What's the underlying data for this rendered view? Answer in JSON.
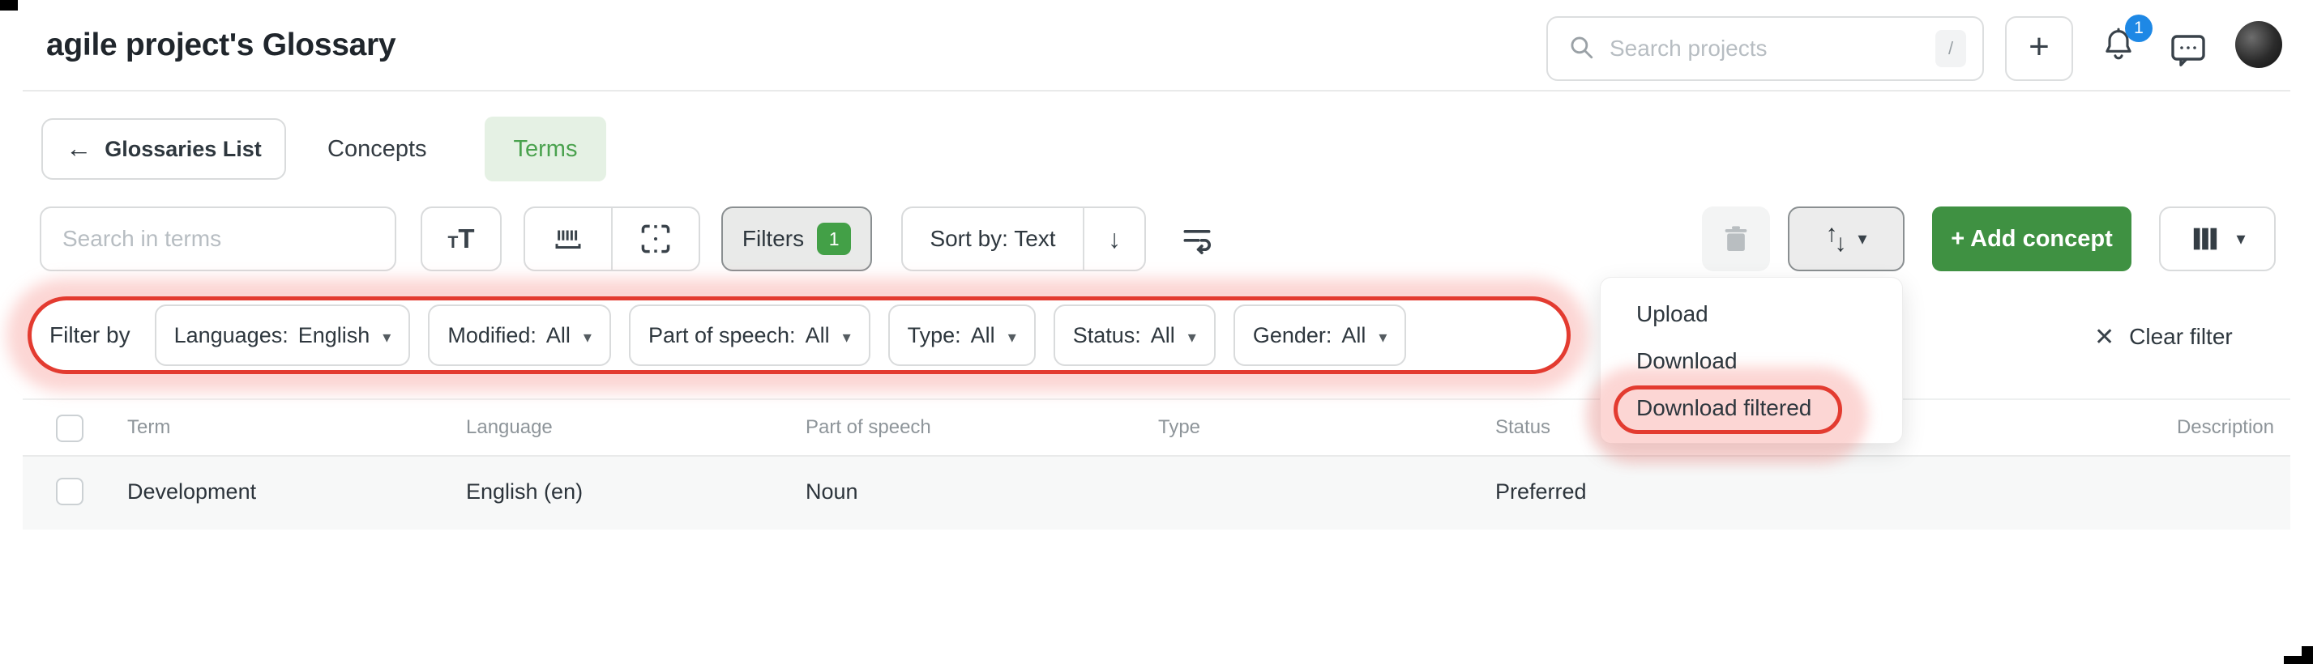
{
  "header": {
    "title": "agile project's Glossary",
    "search": {
      "placeholder": "Search projects",
      "shortcut": "/"
    },
    "notification_count": "1"
  },
  "nav": {
    "back_button": "Glossaries List",
    "tabs": [
      {
        "label": "Concepts",
        "active": false
      },
      {
        "label": "Terms",
        "active": true
      }
    ]
  },
  "toolbar": {
    "search_placeholder": "Search in terms",
    "filters_label": "Filters",
    "filters_count": "1",
    "sort_label": "Sort by: Text",
    "add_concept_label": "+ Add concept"
  },
  "filter_bar": {
    "label": "Filter by",
    "filters": [
      {
        "label": "Languages:",
        "value": "English"
      },
      {
        "label": "Modified:",
        "value": "All"
      },
      {
        "label": "Part of speech:",
        "value": "All"
      },
      {
        "label": "Type:",
        "value": "All"
      },
      {
        "label": "Status:",
        "value": "All"
      },
      {
        "label": "Gender:",
        "value": "All"
      }
    ],
    "clear_label": "Clear filter"
  },
  "dropdown_menu": {
    "items": [
      "Upload",
      "Download",
      "Download filtered"
    ],
    "highlighted": "Download filtered"
  },
  "table": {
    "columns": [
      "Term",
      "Language",
      "Part of speech",
      "Type",
      "Status",
      "Description"
    ],
    "rows": [
      {
        "term": "Development",
        "language": "English (en)",
        "part_of_speech": "Noun",
        "type": "",
        "status": "Preferred",
        "description": ""
      }
    ]
  },
  "colors": {
    "accent_green": "#3f9142",
    "tab_green_bg": "#e5f1e4",
    "tab_green_text": "#4aa24e",
    "badge_green": "#43a047",
    "badge_blue": "#1e88e5",
    "annotation_red": "#e33b30",
    "annotation_glow": "rgba(246,130,124,0.33)",
    "row_bg": "#f7f8f8"
  }
}
